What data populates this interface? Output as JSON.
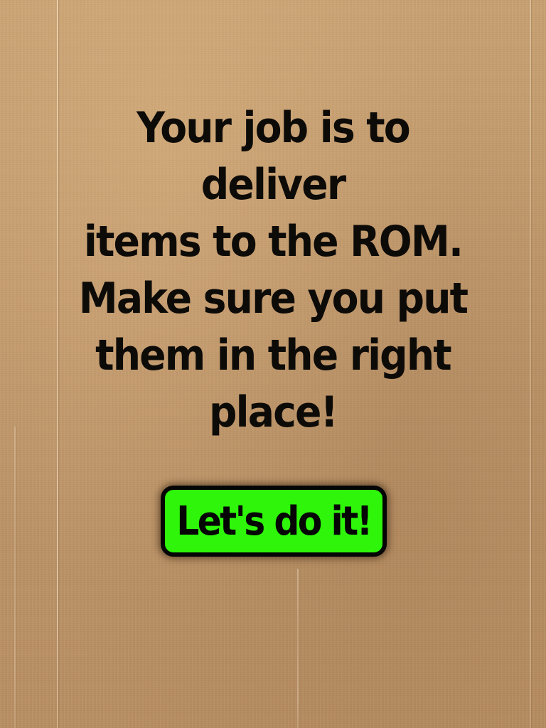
{
  "instructions": {
    "lines": [
      "Your job is to deliver",
      "items to the ROM.",
      "Make sure you put",
      "them in the right",
      "place!"
    ]
  },
  "start_button": {
    "label": "Let's do it!"
  },
  "colors": {
    "background": "#c29a6c",
    "text": "#0d0b08",
    "button_fill": "#2ef50a",
    "button_border": "#050505"
  }
}
